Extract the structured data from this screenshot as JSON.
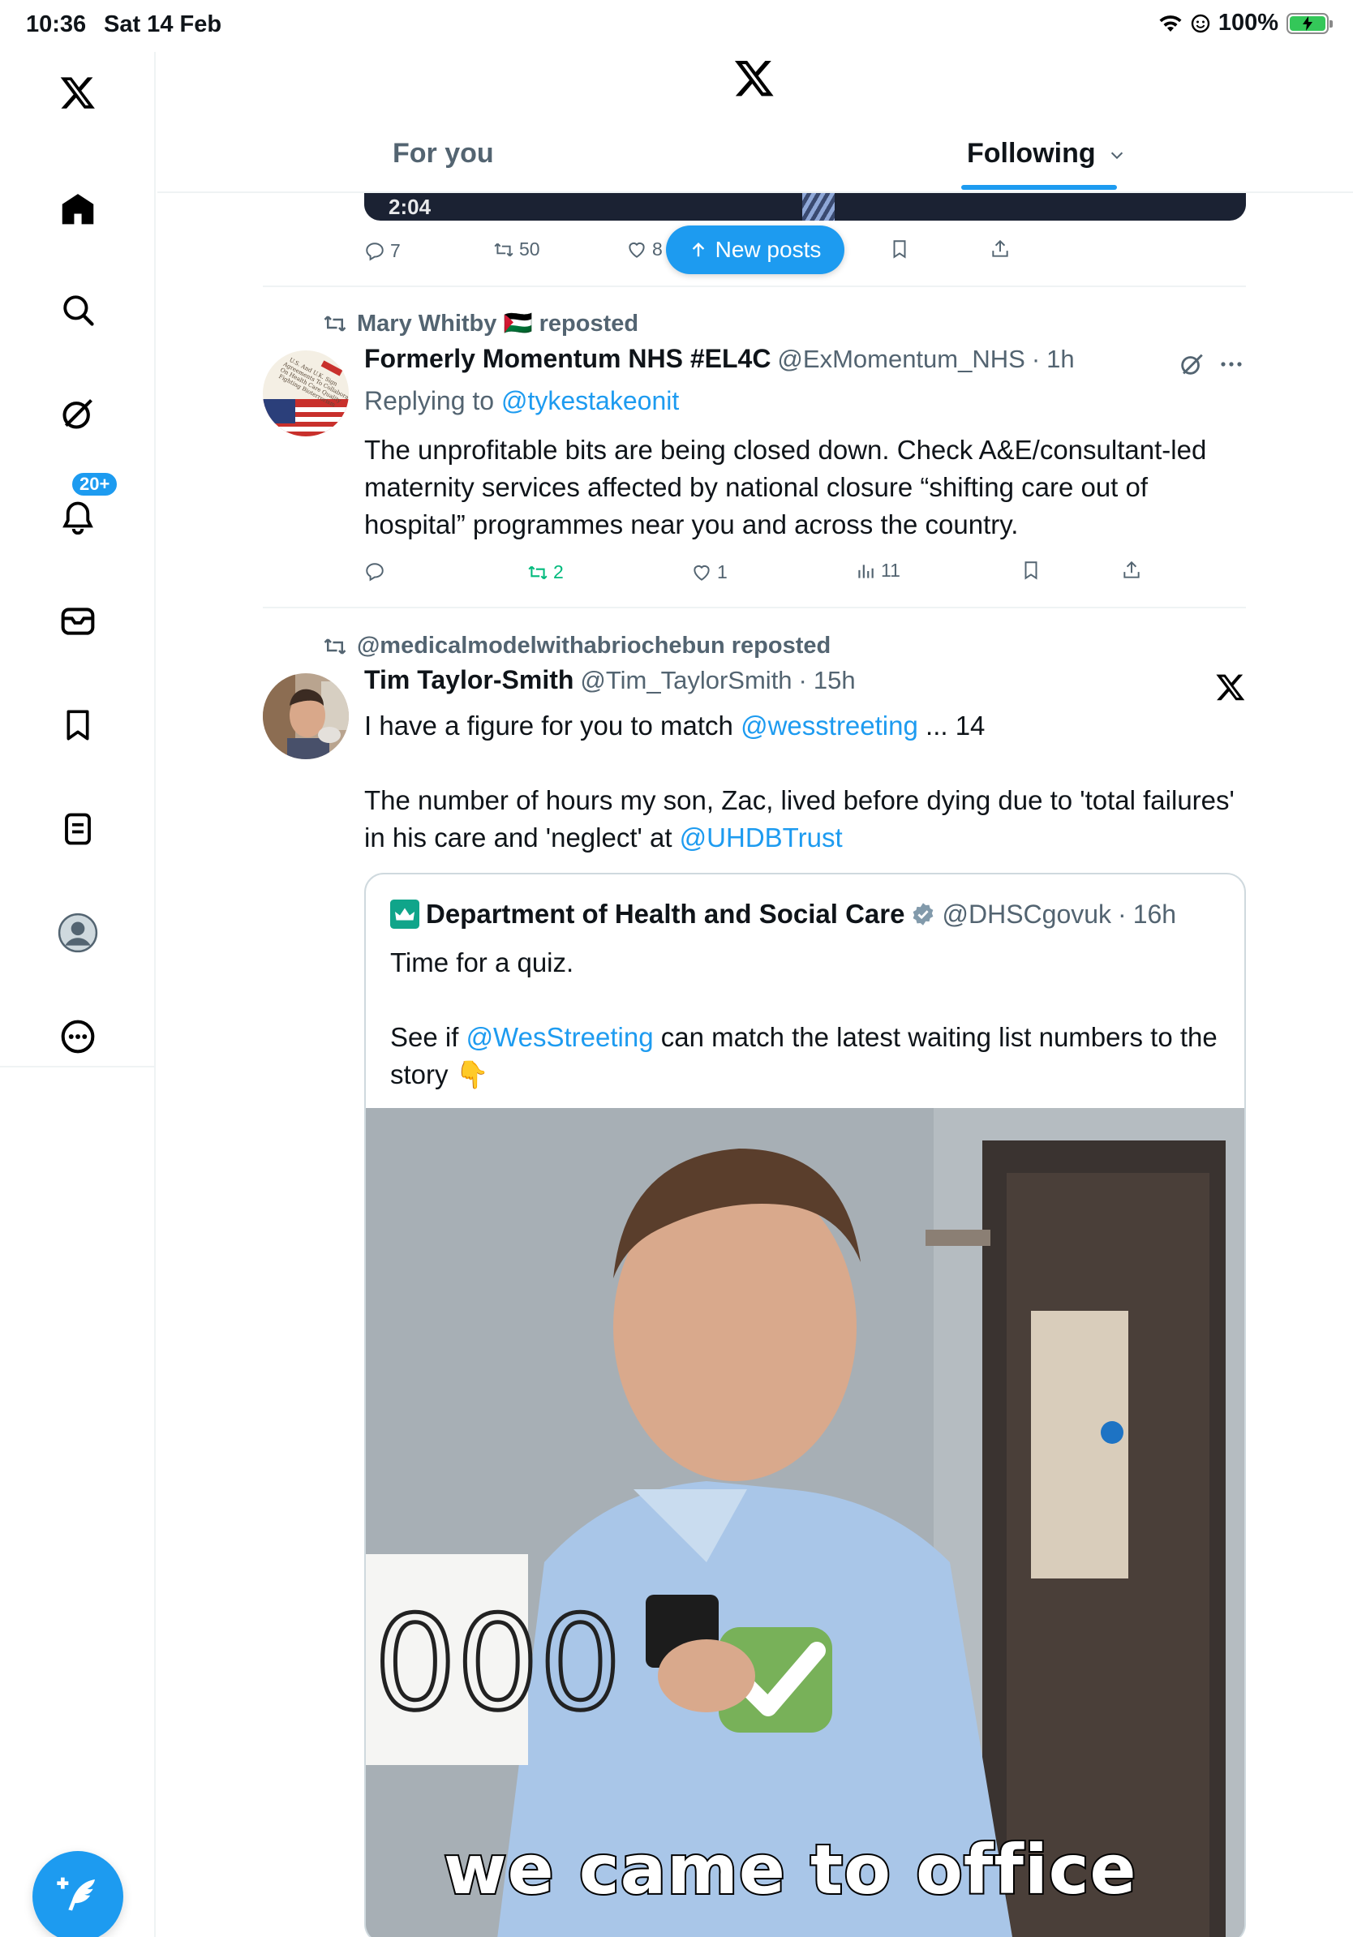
{
  "status_bar": {
    "time": "10:36",
    "date": "Sat 14 Feb",
    "battery": "100%"
  },
  "header": {
    "tabs": [
      {
        "label": "For you",
        "active": false
      },
      {
        "label": "Following",
        "active": true
      }
    ]
  },
  "sidebar": {
    "items": [
      {
        "icon": "x-logo-icon"
      },
      {
        "icon": "home-icon"
      },
      {
        "icon": "search-icon"
      },
      {
        "icon": "grok-icon"
      },
      {
        "icon": "notifications-icon",
        "badge": "20+"
      },
      {
        "icon": "messages-icon"
      },
      {
        "icon": "bookmarks-icon"
      },
      {
        "icon": "lists-icon"
      },
      {
        "icon": "profile-icon"
      },
      {
        "icon": "more-icon"
      }
    ],
    "compose_icon": "compose-icon"
  },
  "top_post": {
    "video_time": "2:04",
    "actions": {
      "replies": "7",
      "reposts": "50",
      "likes": "8"
    }
  },
  "new_posts_label": "New posts",
  "posts": [
    {
      "repost_by": "Mary Whitby 🇵🇸 reposted",
      "name": "Formerly Momentum NHS #EL4C",
      "handle": "@ExMomentum_NHS",
      "time": "1h",
      "replying_label": "Replying to",
      "replying_to": "@tykestakeonit",
      "text": "The unprofitable bits are being closed down. Check A&E/consultant-led maternity services affected by national closure “shifting care out of hospital” programmes near you and across the country.",
      "actions": {
        "replies": "",
        "reposts": "2",
        "likes": "1",
        "views": "11"
      }
    },
    {
      "repost_by": "@medicalmodelwithabriochebun reposted",
      "name": "Tim Taylor-Smith",
      "handle": "@Tim_TaylorSmith",
      "time": "15h",
      "text_1a": "I have a figure for you to match ",
      "text_1_link": "@wesstreeting",
      "text_1b": " ... 14",
      "text_2a": "The number of hours my son, Zac, lived before dying due to 'total failures' in his care and 'neglect' at ",
      "text_2_link": "@UHDBTrust",
      "quote": {
        "name": "Department of Health and Social Care",
        "handle": "@DHSCgovuk",
        "time": "16h",
        "text_1": "Time for a quiz.",
        "text_2a": "See if ",
        "text_2_link": "@WesStreeting",
        "text_2b": " can match the latest waiting list numbers to the story 👇",
        "media_caption": "we came to office"
      }
    }
  ],
  "colors": {
    "accent": "#1d9bf0",
    "repost_green": "#00ba7c",
    "secondary_text": "#536471"
  }
}
